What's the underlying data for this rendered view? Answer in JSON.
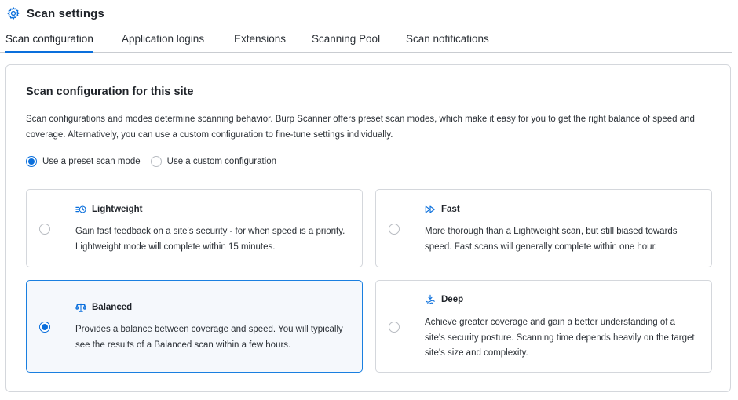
{
  "header": {
    "title": "Scan settings",
    "icon": "gear-icon"
  },
  "tabs": [
    {
      "label": "Scan configuration",
      "active": true
    },
    {
      "label": "Application logins",
      "active": false
    },
    {
      "label": "Extensions",
      "active": false
    },
    {
      "label": "Scanning Pool",
      "active": false
    },
    {
      "label": "Scan notifications",
      "active": false
    }
  ],
  "config": {
    "title": "Scan configuration for this site",
    "description": "Scan configurations and modes determine scanning behavior. Burp Scanner offers preset scan modes, which make it easy for you to get the right balance of speed and coverage. Alternatively, you can use a custom configuration to fine-tune settings individually.",
    "mode_options": [
      {
        "label": "Use a preset scan mode",
        "checked": true
      },
      {
        "label": "Use a custom configuration",
        "checked": false
      }
    ],
    "presets": [
      {
        "name": "Lightweight",
        "icon": "lightweight-clock-icon",
        "selected": false,
        "description": "Gain fast feedback on a site's security - for when speed is a priority. Lightweight mode will complete within 15 minutes."
      },
      {
        "name": "Fast",
        "icon": "fast-forward-icon",
        "selected": false,
        "description": "More thorough than a Lightweight scan, but still biased towards speed. Fast scans will generally complete within one hour."
      },
      {
        "name": "Balanced",
        "icon": "balance-scale-icon",
        "selected": true,
        "description": "Provides a balance between coverage and speed. You will typically see the results of a Balanced scan within a few hours."
      },
      {
        "name": "Deep",
        "icon": "deep-dive-icon",
        "selected": false,
        "description": "Achieve greater coverage and gain a better understanding of a site's security posture. Scanning time depends heavily on the target site's size and complexity."
      }
    ]
  },
  "colors": {
    "accent": "#0a6fdc",
    "border": "#d4d7dc",
    "selected_bg": "#f5f8fc"
  }
}
